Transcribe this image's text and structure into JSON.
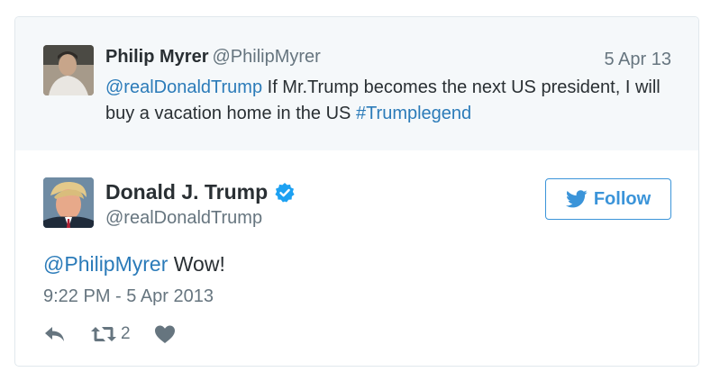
{
  "parent_tweet": {
    "author_name": "Philip Myrer",
    "author_handle": "@PhilipMyrer",
    "date": "5 Apr 13",
    "mention": "@realDonaldTrump",
    "text": " If Mr.Trump becomes the next US president, I will buy a vacation home in the US ",
    "hashtag": "#Trumplegend"
  },
  "tweet": {
    "author_name": "Donald J. Trump",
    "author_handle": "@realDonaldTrump",
    "verified_icon": "verified-badge-icon",
    "mention": "@PhilipMyrer",
    "text": " Wow!",
    "timestamp": "9:22 PM - 5 Apr 2013",
    "retweet_count": "2"
  },
  "follow_button": {
    "label": "Follow",
    "icon": "twitter-bird-icon"
  },
  "colors": {
    "link": "#2b7bb9",
    "accent": "#3b94d9",
    "muted": "#66757f",
    "parent_bg": "#f5f8fa",
    "verified": "#1da1f2"
  }
}
